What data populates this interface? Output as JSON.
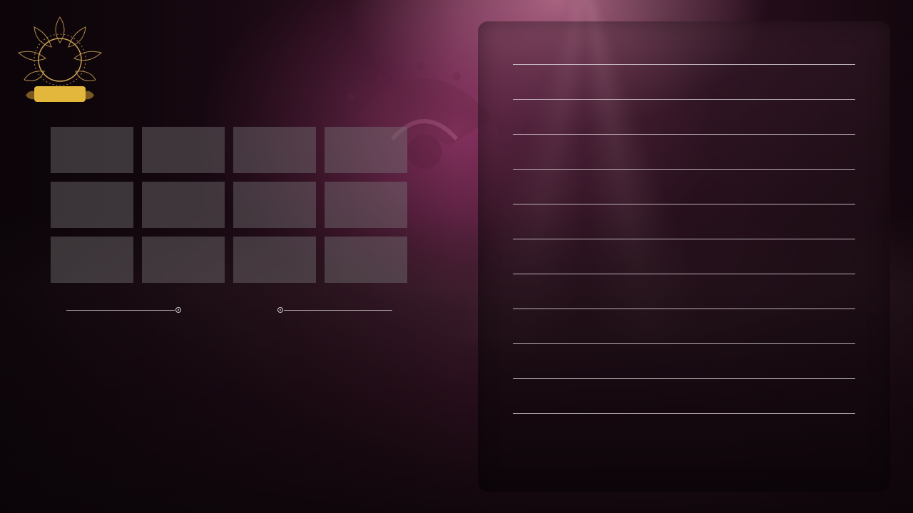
{
  "emblem": {
    "icon": "lotus-emblem-icon",
    "label": ""
  },
  "grid": {
    "tiles": [
      {
        "label": ""
      },
      {
        "label": ""
      },
      {
        "label": ""
      },
      {
        "label": ""
      },
      {
        "label": ""
      },
      {
        "label": ""
      },
      {
        "label": ""
      },
      {
        "label": ""
      },
      {
        "label": ""
      },
      {
        "label": ""
      },
      {
        "label": ""
      },
      {
        "label": ""
      }
    ]
  },
  "pager": {
    "left_icon": "slider-knob-icon",
    "right_icon": "slider-knob-icon"
  },
  "panel": {
    "rows": [
      {
        "text": ""
      },
      {
        "text": ""
      },
      {
        "text": ""
      },
      {
        "text": ""
      },
      {
        "text": ""
      },
      {
        "text": ""
      },
      {
        "text": ""
      },
      {
        "text": ""
      },
      {
        "text": ""
      },
      {
        "text": ""
      },
      {
        "text": ""
      }
    ]
  },
  "colors": {
    "gold": "#e3b63c",
    "tile": "#7a787a",
    "accent": "#c44a8c"
  }
}
